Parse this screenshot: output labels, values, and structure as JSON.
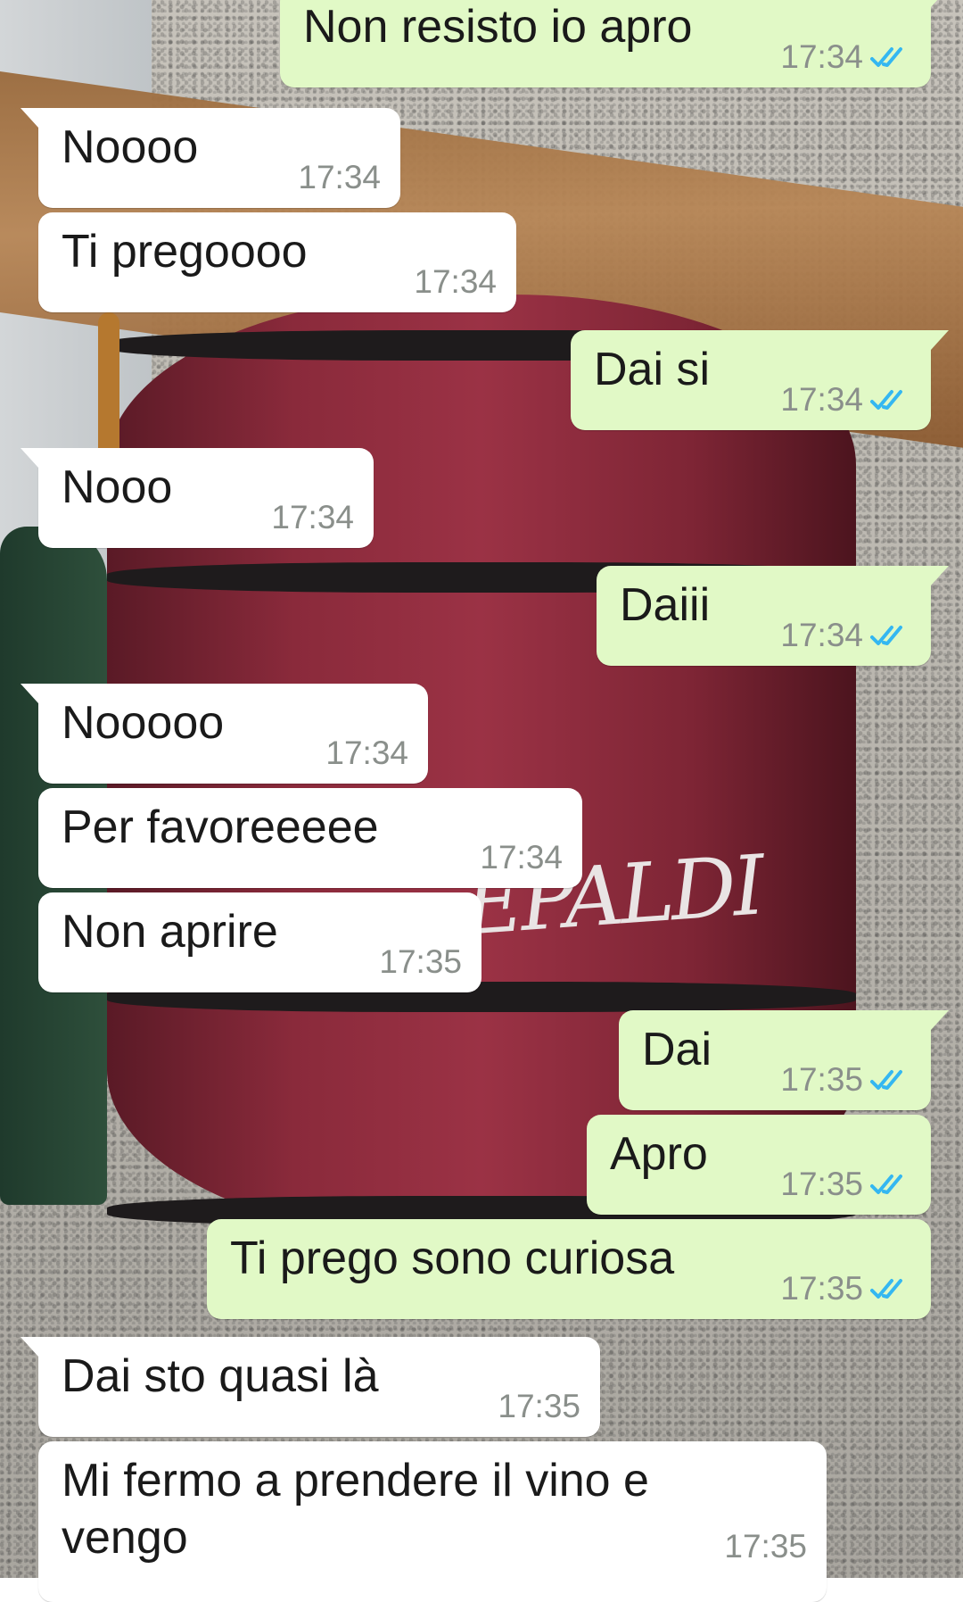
{
  "wallpaper": {
    "text": "EPALDI"
  },
  "colors": {
    "incoming_bubble": "#ffffff",
    "outgoing_bubble": "#e1f9c6",
    "read_receipt": "#34b7f1",
    "timestamp": "#8a8f8b"
  },
  "messages": [
    {
      "direction": "outgoing",
      "text": "Non resisto io apro",
      "time": "17:34",
      "status_icon": "double-check-read-icon"
    },
    {
      "direction": "incoming",
      "text": "Noooo",
      "time": "17:34"
    },
    {
      "direction": "incoming",
      "text": "Ti pregoooo",
      "time": "17:34"
    },
    {
      "direction": "outgoing",
      "text": "Dai si",
      "time": "17:34",
      "status_icon": "double-check-read-icon"
    },
    {
      "direction": "incoming",
      "text": "Nooo",
      "time": "17:34"
    },
    {
      "direction": "outgoing",
      "text": "Daiii",
      "time": "17:34",
      "status_icon": "double-check-read-icon"
    },
    {
      "direction": "incoming",
      "text": "Nooooo",
      "time": "17:34"
    },
    {
      "direction": "incoming",
      "text": "Per favoreeeee",
      "time": "17:34"
    },
    {
      "direction": "incoming",
      "text": "Non aprire",
      "time": "17:35"
    },
    {
      "direction": "outgoing",
      "text": "Dai",
      "time": "17:35",
      "status_icon": "double-check-read-icon"
    },
    {
      "direction": "outgoing",
      "text": "Apro",
      "time": "17:35",
      "status_icon": "double-check-read-icon"
    },
    {
      "direction": "outgoing",
      "text": "Ti prego sono curiosa",
      "time": "17:35",
      "status_icon": "double-check-read-icon"
    },
    {
      "direction": "incoming",
      "text": "Dai sto quasi là",
      "time": "17:35"
    },
    {
      "direction": "incoming",
      "text": "Mi fermo a prendere il vino e vengo",
      "time": "17:35"
    }
  ]
}
